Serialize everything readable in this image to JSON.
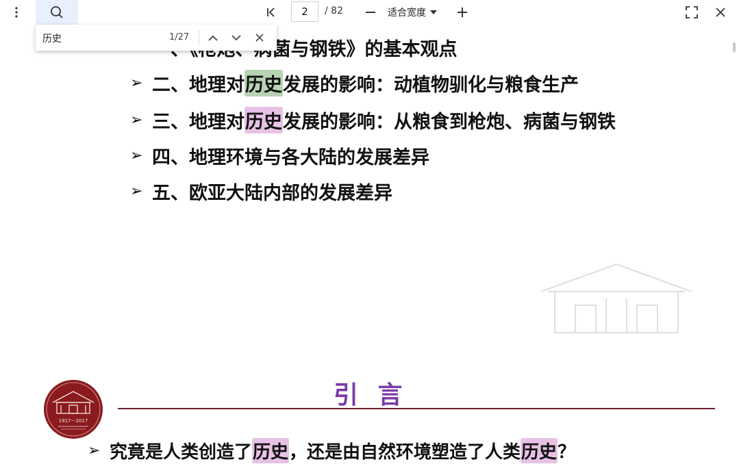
{
  "toolbar": {
    "more_icon": "more-vert-icon",
    "search_icon": "search-icon",
    "first_page_icon": "first-page-icon",
    "page_current": "2",
    "page_total": "/ 82",
    "zoom_out_icon": "minus-icon",
    "zoom_mode": "适合宽度",
    "zoom_in_icon": "plus-icon",
    "fullscreen_icon": "fullscreen-icon",
    "close_icon": "close-icon"
  },
  "find": {
    "query": "历史",
    "count": "1/27"
  },
  "document": {
    "outline_items": [
      {
        "arrow": "➢",
        "before": "一、《枪炮、病菌与钢铁》的基本观点",
        "hl": "",
        "after": ""
      },
      {
        "arrow": "➢",
        "before": "二、地理对",
        "hl": "历史",
        "after": "发展的影响：动植物驯化与粮食生产"
      },
      {
        "arrow": "➢",
        "before": "三、地理对",
        "hl": "历史",
        "after": "发展的影响：从粮食到枪炮、病菌与钢铁"
      },
      {
        "arrow": "➢",
        "before": "四、地理环境与各大陆的发展差异",
        "hl": "",
        "after": ""
      },
      {
        "arrow": "➢",
        "before": "五、欧亚大陆内部的发展差异",
        "hl": "",
        "after": ""
      }
    ],
    "section_title": "引 言",
    "logo_years": "1917－2017",
    "question": {
      "arrow": "➢",
      "p1": "究竟是人类创造了",
      "h1": "历史",
      "p2": "，还是由自然环境塑造了人类",
      "h2": "历史",
      "p3": "？"
    }
  },
  "colors": {
    "highlight": "#e7c2e6",
    "current_highlight": "#b7d3b3",
    "section_title": "#7a3aa8",
    "section_line": "#6a1f2b",
    "logo_bg": "#8b1a1f"
  }
}
